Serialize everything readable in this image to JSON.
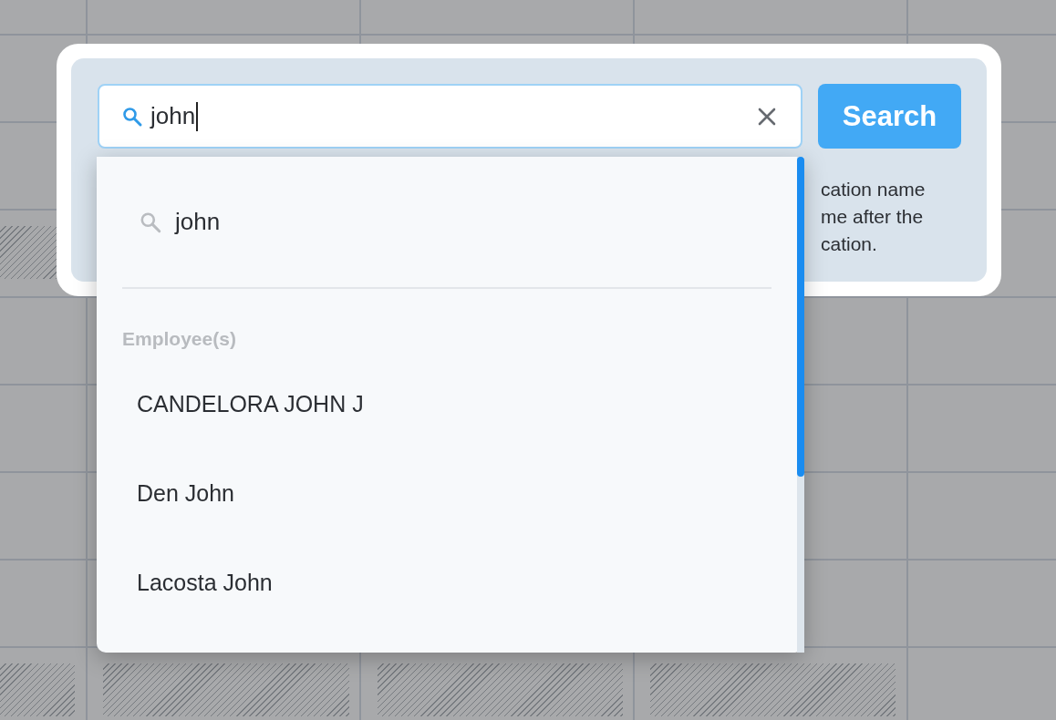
{
  "search": {
    "value": "john",
    "button": "Search"
  },
  "help_text": [
    "cation name",
    "me after the",
    "cation."
  ],
  "dropdown": {
    "query": "john",
    "group": "Employee(s)",
    "items": [
      {
        "label": "CANDELORA JOHN J"
      },
      {
        "label": "Den John"
      },
      {
        "label": "Lacosta John"
      }
    ]
  }
}
